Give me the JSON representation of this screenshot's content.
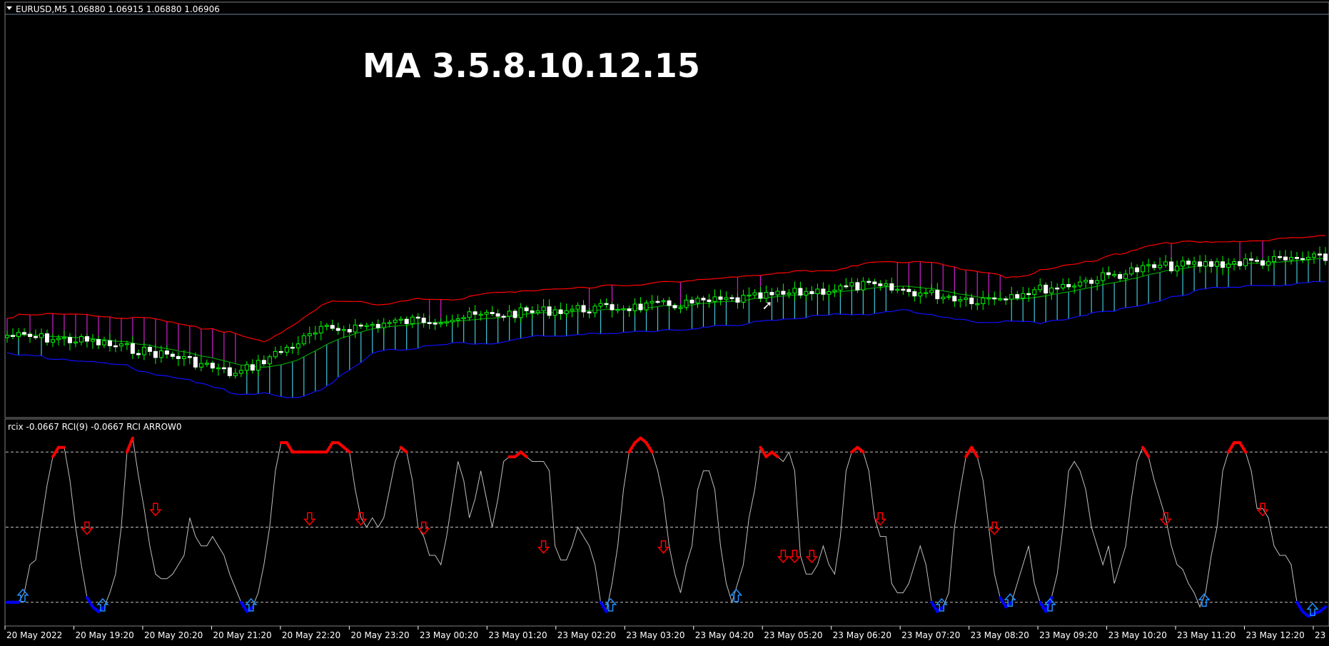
{
  "main_chart": {
    "symbol_line": "EURUSD,M5  1.06880 1.06915 1.06880 1.06906",
    "overlay_title": "MA 3.5.8.10.12.15",
    "signal_arrows": [
      {
        "index": 133,
        "glyph": "➚"
      },
      {
        "index": 237,
        "glyph": "➚"
      }
    ]
  },
  "sub_window": {
    "label": "rcix -0.0667  RCI(9) -0.0667  RCI ARROW0",
    "levels": [
      80,
      0,
      -80
    ],
    "y_range": [
      -100,
      100
    ]
  },
  "time_axis": {
    "labels": [
      "20 May 2022",
      "20 May 19:20",
      "20 May 20:20",
      "20 May 21:20",
      "20 May 22:20",
      "20 May 23:20",
      "23 May 00:20",
      "23 May 01:20",
      "23 May 02:20",
      "23 May 03:20",
      "23 May 04:20",
      "23 May 05:20",
      "23 May 06:20",
      "23 May 07:20",
      "23 May 08:20",
      "23 May 09:20",
      "23 May 10:20",
      "23 May 11:20",
      "23 May 12:20",
      "23 Ma"
    ]
  },
  "colors": {
    "background": "#000000",
    "bull_candle": "#00ff00",
    "bear_candle": "#ffffff",
    "upper_band": "#ff0000",
    "lower_band": "#1010ff",
    "mid_band": "#00a000",
    "hist_up": "#40c8d8",
    "hist_down": "#d020d0",
    "rci_line": "#bfbfbf",
    "rci_high": "#ff0000",
    "rci_low": "#0000ff",
    "arrow_up": "#1e90ff",
    "arrow_down": "#ff0000",
    "grid_text": "#ffffff"
  },
  "chart_data": {
    "type": "line",
    "rci": {
      "name": "RCI(9)",
      "values": [
        -80,
        -80,
        -80,
        -70,
        -40,
        -35,
        5,
        45,
        75,
        85,
        85,
        50,
        0,
        -40,
        -75,
        -85,
        -90,
        -85,
        -70,
        -50,
        0,
        80,
        95,
        55,
        20,
        -20,
        -50,
        -55,
        -55,
        -50,
        -40,
        -30,
        10,
        -10,
        -20,
        -20,
        -10,
        -20,
        -30,
        -50,
        -65,
        -80,
        -90,
        -85,
        -70,
        -40,
        0,
        60,
        90,
        90,
        80,
        80,
        80,
        80,
        80,
        80,
        80,
        90,
        90,
        85,
        80,
        40,
        10,
        0,
        10,
        0,
        10,
        40,
        70,
        85,
        80,
        50,
        0,
        -10,
        -30,
        -30,
        -40,
        -10,
        30,
        70,
        50,
        10,
        30,
        60,
        30,
        0,
        30,
        70,
        75,
        75,
        80,
        75,
        70,
        70,
        70,
        60,
        -20,
        -35,
        -35,
        -20,
        0,
        -10,
        -20,
        -40,
        -80,
        -90,
        -60,
        -20,
        40,
        80,
        90,
        95,
        90,
        80,
        60,
        30,
        -20,
        -50,
        -70,
        -40,
        -20,
        40,
        60,
        60,
        40,
        -20,
        -60,
        -80,
        -60,
        -40,
        10,
        40,
        85,
        75,
        80,
        75,
        70,
        80,
        60,
        -30,
        -50,
        -50,
        -40,
        -20,
        -40,
        -50,
        -10,
        60,
        80,
        85,
        80,
        60,
        10,
        -10,
        -10,
        -60,
        -70,
        -70,
        -60,
        -40,
        -20,
        -40,
        -80,
        -90,
        -85,
        -70,
        0,
        40,
        75,
        85,
        75,
        50,
        0,
        -50,
        -75,
        -85,
        -80,
        -60,
        -40,
        -20,
        -60,
        -80,
        -90,
        -75,
        -50,
        0,
        60,
        70,
        60,
        40,
        0,
        -20,
        -40,
        -20,
        -60,
        -40,
        -20,
        30,
        70,
        85,
        75,
        50,
        30,
        10,
        -20,
        -40,
        -45,
        -60,
        -70,
        -85,
        -70,
        -30,
        0,
        60,
        80,
        90,
        90,
        80,
        60,
        20,
        20,
        10,
        -20,
        -30,
        -30,
        -40,
        -80,
        -90,
        -95,
        -92,
        -90,
        -85
      ]
    },
    "price": {
      "name": "EURUSD,M5",
      "ylim": [
        1.0584,
        1.0702
      ]
    }
  }
}
